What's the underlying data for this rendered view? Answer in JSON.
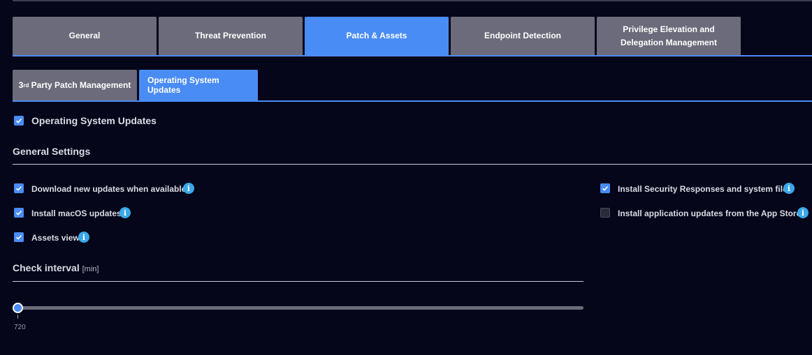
{
  "main_tabs": [
    {
      "label": "General"
    },
    {
      "label": "Threat Prevention"
    },
    {
      "label": "Patch & Assets"
    },
    {
      "label": "Endpoint Detection"
    },
    {
      "label": "Privilege Elevation and Delegation Management"
    }
  ],
  "active_main_tab": "Patch & Assets",
  "sub_tabs": {
    "third_party_number": "3",
    "third_party_suffix": "rd",
    "third_party_rest": " Party Patch Management",
    "os_updates": "Operating System Updates"
  },
  "active_sub_tab": "Operating System Updates",
  "master_toggle": {
    "label": "Operating System Updates",
    "checked": true
  },
  "general_settings": {
    "title": "General Settings",
    "left_options": [
      {
        "label": "Download new updates when available",
        "checked": true
      },
      {
        "label": "Install macOS updates",
        "checked": true
      },
      {
        "label": "Assets view",
        "checked": true
      }
    ],
    "right_options": [
      {
        "label": "Install Security Responses and system files",
        "checked": true
      },
      {
        "label": "Install application updates from the App Store",
        "checked": false
      }
    ],
    "info_glyph": "i"
  },
  "check_interval": {
    "title": "Check interval",
    "unit": "[min]",
    "value": "720"
  },
  "colors": {
    "background": "#05061a",
    "accent": "#4a8cf5",
    "tab_inactive": "#6b6b7b",
    "info": "#3aa8e8"
  },
  "icons": {
    "checkbox_checked": "checkmark-icon",
    "info": "info-icon"
  }
}
